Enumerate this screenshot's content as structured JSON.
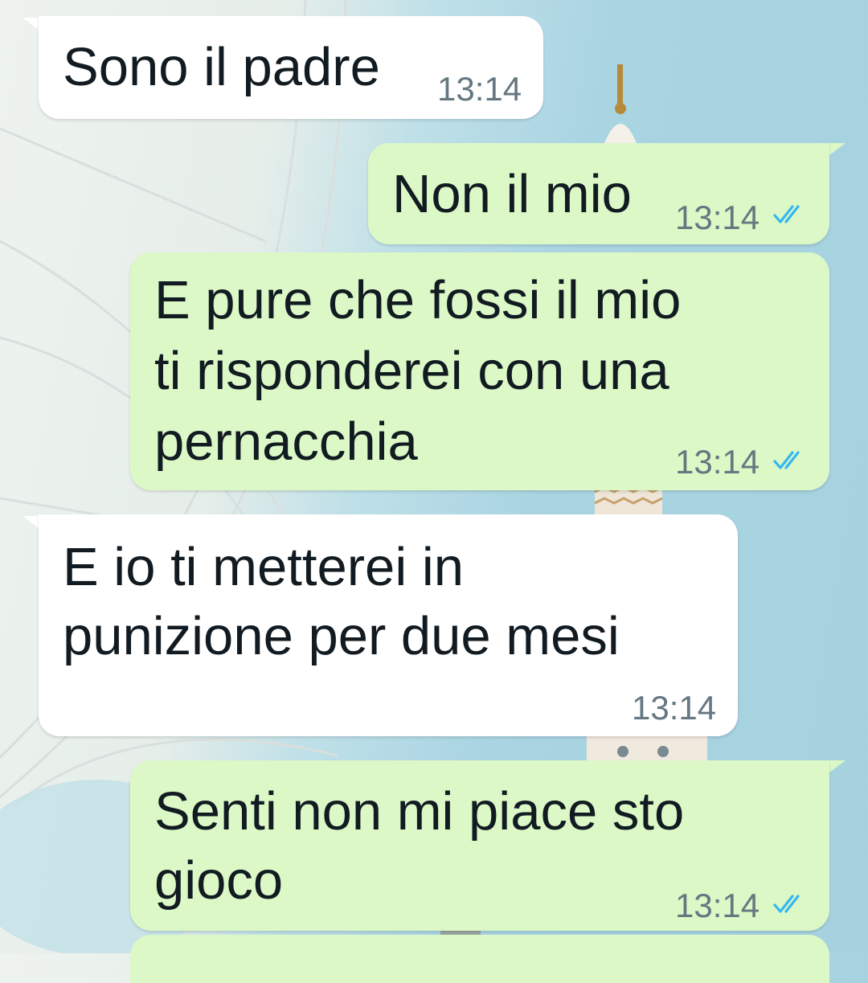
{
  "messages": [
    {
      "id": 1,
      "direction": "incoming",
      "text": [
        "Sono il padre"
      ],
      "time": "13:14"
    },
    {
      "id": 2,
      "direction": "outgoing",
      "text": [
        "Non il mio"
      ],
      "time": "13:14",
      "status": "read"
    },
    {
      "id": 3,
      "direction": "outgoing",
      "text": [
        "E pure che fossi il mio",
        "ti risponderei con una",
        "pernacchia"
      ],
      "time": "13:14",
      "status": "read"
    },
    {
      "id": 4,
      "direction": "incoming",
      "text": [
        "E io ti metterei in",
        "punizione per due mesi"
      ],
      "time": "13:14"
    },
    {
      "id": 5,
      "direction": "outgoing",
      "text": [
        "Senti non mi piace sto",
        "gioco"
      ],
      "time": "13:14",
      "status": "read"
    }
  ],
  "colors": {
    "incoming_bubble": "#ffffff",
    "outgoing_bubble": "#dcf8c6",
    "read_ticks": "#34b7f1",
    "timestamp": "#667781"
  },
  "icons": {
    "read_status": "double-check-icon"
  }
}
